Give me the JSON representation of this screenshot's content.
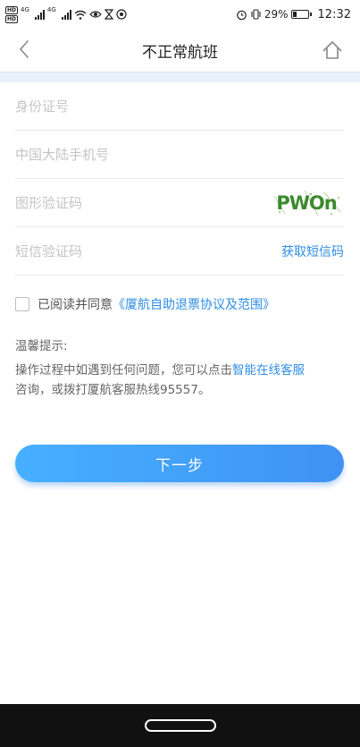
{
  "status_bar": {
    "network_type": "4G",
    "battery_percent": "29%",
    "time": "12:32"
  },
  "nav": {
    "title": "不正常航班"
  },
  "form": {
    "id_placeholder": "身份证号",
    "phone_placeholder": "中国大陆手机号",
    "captcha_placeholder": "图形验证码",
    "captcha_text": "PWOn",
    "sms_placeholder": "短信验证码",
    "sms_button_label": "获取短信码"
  },
  "agreement": {
    "prefix": "已阅读并同意",
    "link_text": "《厦航自助退票协议及范围》"
  },
  "tips": {
    "title": "温馨提示:",
    "line1_prefix": "操作过程中如遇到任何问题，您可以点击",
    "link_text": "智能在线客服",
    "line2": "咨询，或拨打厦航客服热线95557。"
  },
  "button": {
    "next_label": "下一步"
  },
  "colors": {
    "accent": "#2f8de4",
    "button_start": "#46b0ff",
    "button_end": "#3f92f3",
    "placeholder": "#c4c4c4",
    "nav_divider": "#e9f2fb",
    "captcha_text": "#3d8a2e"
  },
  "icons": [
    "back-arrow-icon",
    "home-icon",
    "wifi-icon",
    "eye-icon",
    "hourglass-icon",
    "alarm-icon",
    "vibrate-icon",
    "battery-icon"
  ]
}
